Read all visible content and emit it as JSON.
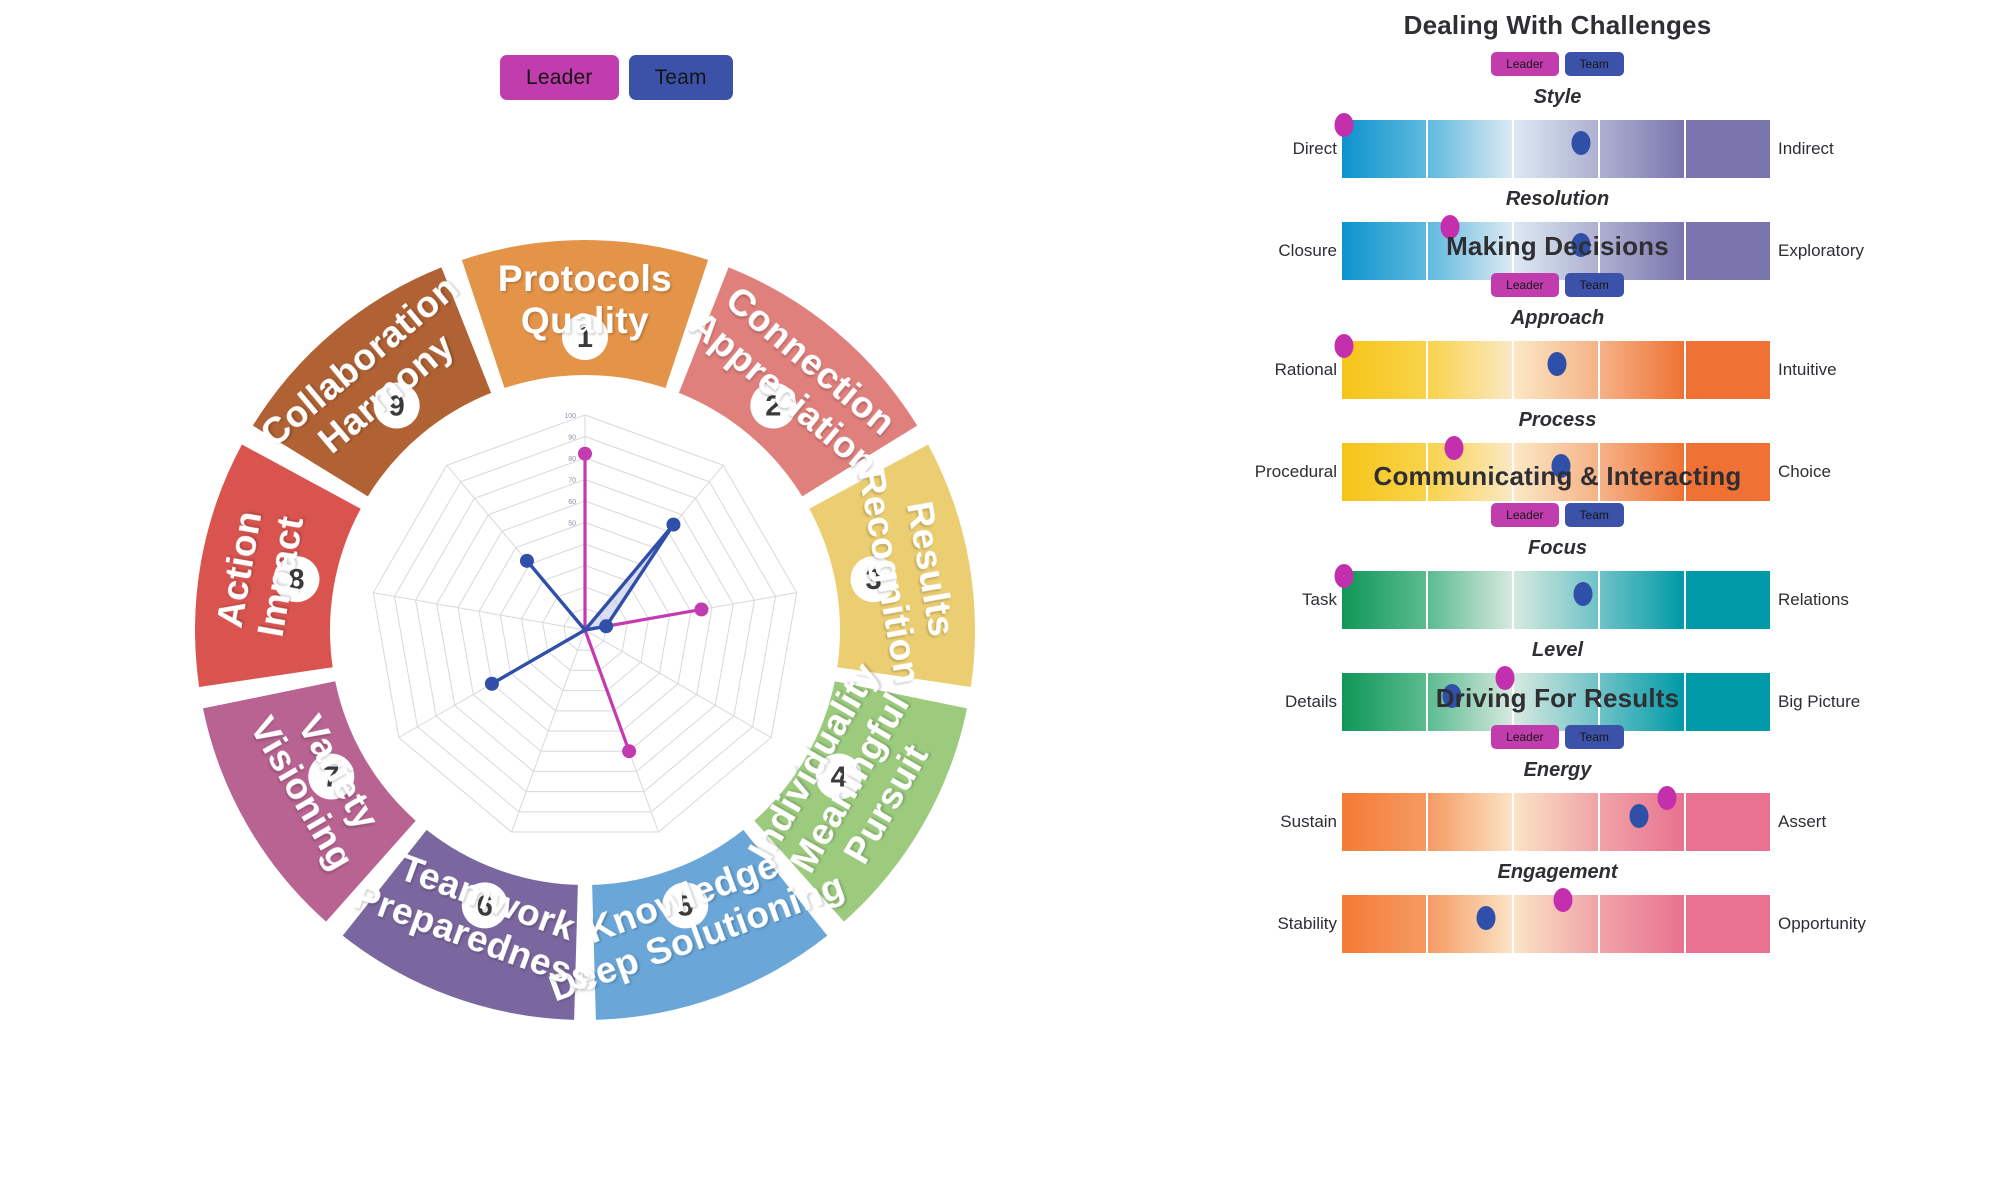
{
  "legend": {
    "leader": "Leader",
    "team": "Team"
  },
  "colors": {
    "leader": "#c13cac",
    "team": "#3c52a8"
  },
  "wheel": {
    "segments": [
      {
        "number": "1",
        "line1": "Protocols",
        "line2": "Quality",
        "color": "#e49449"
      },
      {
        "number": "2",
        "line1": "Connection",
        "line2": "Appreciation",
        "color": "#e0807c"
      },
      {
        "number": "3",
        "line1": "Results",
        "line2": "Recognition",
        "color": "#ecce72"
      },
      {
        "number": "4",
        "line1": "Individuality",
        "line2": "Meaningful",
        "line3": "Pursuit",
        "color": "#9ccb7e"
      },
      {
        "number": "5",
        "line1": "Knowledge",
        "line2": "Deep Solutioning",
        "color": "#6aa7d8"
      },
      {
        "number": "6",
        "line1": "Teamwork",
        "line2": "Preparedness",
        "color": "#7b679f"
      },
      {
        "number": "7",
        "line1": "Variety",
        "line2": "Visioning",
        "color": "#b86391"
      },
      {
        "number": "8",
        "line1": "Action",
        "line2": "Impact",
        "color": "#d9544f"
      },
      {
        "number": "9",
        "line1": "Collaboration",
        "line2": "Harmony",
        "color": "#b06234"
      }
    ]
  },
  "chart_data": {
    "type": "line",
    "title": "",
    "subtype": "radar",
    "categories": [
      "Protocols Quality",
      "Connection Appreciation",
      "Results Recognition",
      "Individuality Meaningful Pursuit",
      "Knowledge Deep Solutioning",
      "Teamwork Preparedness",
      "Variety Visioning",
      "Action Impact",
      "Collaboration Harmony"
    ],
    "tick_labels": [
      "50",
      "60",
      "70",
      "80",
      "90",
      "100"
    ],
    "rlim": [
      0,
      100
    ],
    "grid": true,
    "legend_position": "top",
    "series": [
      {
        "name": "Leader",
        "color": "#c43ab0",
        "values": [
          82,
          0,
          55,
          0,
          60,
          0,
          0,
          0,
          0
        ]
      },
      {
        "name": "Team",
        "color": "#2f4fa8",
        "values": [
          0,
          64,
          10,
          0,
          0,
          0,
          50,
          0,
          42
        ]
      }
    ]
  },
  "sections": [
    {
      "title": "Dealing With Challenges",
      "palette": [
        "#0d93cd",
        "#5fb9de",
        "#dce9f2",
        "#aeb0d0",
        "#7a76ad"
      ],
      "sliders": [
        {
          "caption": "Style",
          "left_label": "Direct",
          "right_label": "Indirect",
          "leader_pos": 0.5,
          "team_pos": 55.5
        },
        {
          "caption": "Resolution",
          "left_label": "Closure",
          "right_label": "Exploratory",
          "leader_pos": 25.0,
          "team_pos": 55.5
        }
      ]
    },
    {
      "title": "Making Decisions",
      "palette": [
        "#f6c518",
        "#f8d34b",
        "#fbe8c4",
        "#f5b287",
        "#ef7134"
      ],
      "sliders": [
        {
          "caption": "Approach",
          "left_label": "Rational",
          "right_label": "Intuitive",
          "leader_pos": 0.5,
          "team_pos": 50.0
        },
        {
          "caption": "Process",
          "left_label": "Procedural",
          "right_label": "Choice",
          "leader_pos": 26.0,
          "team_pos": 51.0
        }
      ]
    },
    {
      "title": "Communicating & Interacting",
      "palette": [
        "#0f9757",
        "#5cbb8f",
        "#d7e9df",
        "#6ec2c7",
        "#009aa8"
      ],
      "sliders": [
        {
          "caption": "Focus",
          "left_label": "Task",
          "right_label": "Relations",
          "leader_pos": 0.5,
          "team_pos": 56.0
        },
        {
          "caption": "Level",
          "left_label": "Details",
          "right_label": "Big Picture",
          "leader_pos": 38.0,
          "team_pos": 25.5
        }
      ]
    },
    {
      "title": "Driving For Results",
      "palette": [
        "#f37b35",
        "#f59a63",
        "#fbe3c5",
        "#f0a3a8",
        "#e8728f"
      ],
      "sliders": [
        {
          "caption": "Energy",
          "left_label": "Sustain",
          "right_label": "Assert",
          "leader_pos": 75.5,
          "team_pos": 69.0
        },
        {
          "caption": "Engagement",
          "left_label": "Stability",
          "right_label": "Opportunity",
          "leader_pos": 51.5,
          "team_pos": 33.5
        }
      ]
    }
  ]
}
